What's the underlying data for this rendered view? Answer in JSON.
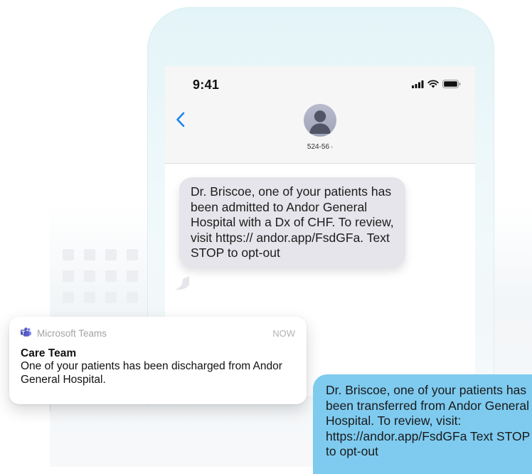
{
  "status_bar": {
    "time": "9:41",
    "icons": [
      "signal-icon",
      "wifi-icon",
      "battery-icon"
    ]
  },
  "conversation": {
    "contact_name": "524-56",
    "contact_chevron": "›"
  },
  "messages": {
    "received": "Dr. Briscoe, one of your patients has been admitted to Andor General Hospital with a Dx of CHF. To review, visit https:// andor.app/FsdGFa. Text STOP to opt-out",
    "sent": "Dr. Briscoe, one of your patients has been transferred from Andor General Hospital. To review, visit: https://andor.app/FsdGFa Text STOP to opt-out"
  },
  "notification": {
    "app_name": "Microsoft Teams",
    "time": "NOW",
    "title": "Care Team",
    "body": "One of your patients has been discharged from Andor General Hospital."
  },
  "colors": {
    "received_bubble": "#e6e5eb",
    "sent_bubble": "#7fcbf0",
    "ios_blue": "#1f84ea",
    "phone_frame": "#e3f4f8",
    "teams_purple": "#5b5fc7"
  }
}
